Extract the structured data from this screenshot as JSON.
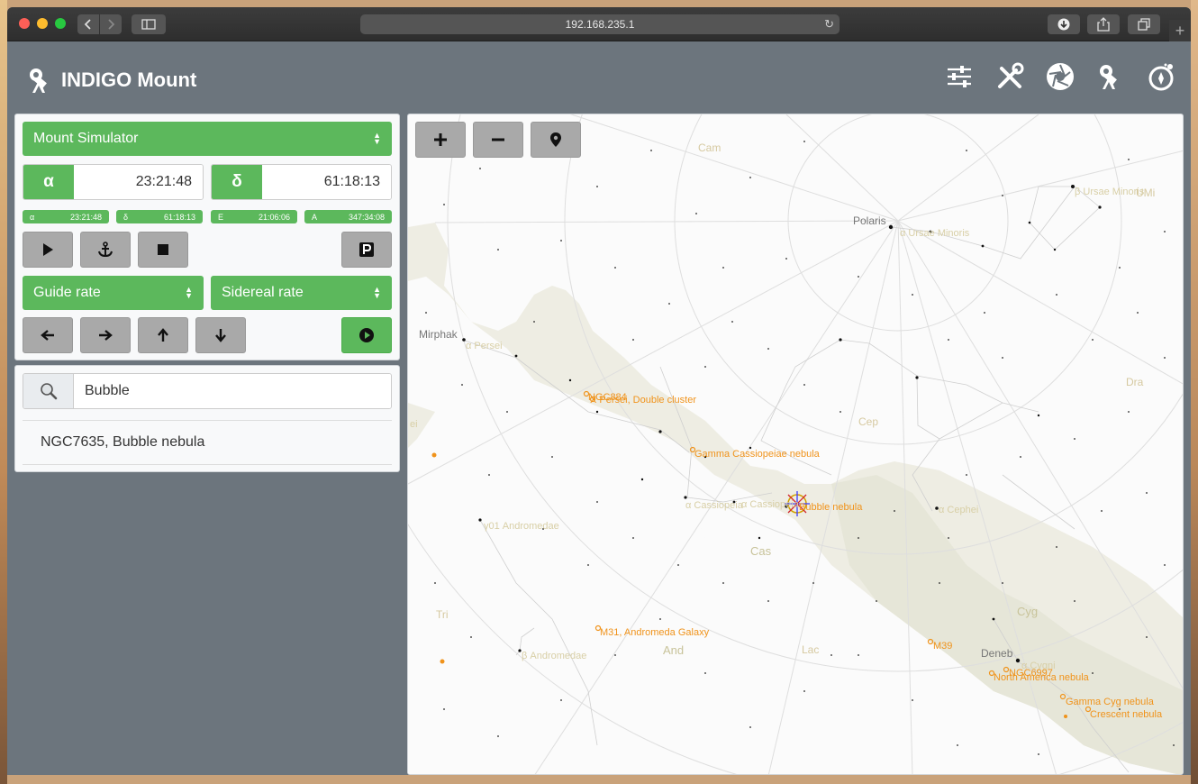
{
  "browser": {
    "url": "192.168.235.1"
  },
  "app": {
    "title": "INDIGO Mount",
    "top_icons": [
      "sliders-icon",
      "tools-icon",
      "aperture-icon",
      "telescope-icon",
      "sky-compass-icon"
    ]
  },
  "mount": {
    "device": "Mount Simulator",
    "alpha_label": "α",
    "alpha_value": "23:21:48",
    "delta_label": "δ",
    "delta_value": "61:18:13",
    "badges": [
      {
        "label": "α",
        "value": "23:21:48"
      },
      {
        "label": "δ",
        "value": "61:18:13"
      },
      {
        "label": "E",
        "value": "21:06:06"
      },
      {
        "label": "A",
        "value": "347:34:08"
      }
    ],
    "guide_rate": "Guide rate",
    "tracking_rate": "Sidereal rate"
  },
  "search": {
    "query": "Bubble",
    "results": [
      "NGC7635, Bubble nebula"
    ]
  },
  "map": {
    "constellations": [
      "Cam",
      "UMi",
      "Dra",
      "Cep",
      "Cas",
      "Cyg",
      "Lac",
      "And",
      "Tri"
    ],
    "stars": [
      "Polaris",
      "α Ursae Minoris",
      "β Ursae Minoris",
      "Mirphak",
      "α Persei",
      "α Cassiopeia",
      "α Cassiopeia",
      "α Cephei",
      "γ01 Andromedae",
      "β Andromedae",
      "Deneb",
      "α Cygni",
      "ei"
    ],
    "dso": [
      "NGC884",
      "X Persei, Double cluster",
      "Gamma Cassiopeiae nebula",
      "Bubble nebula",
      "M31, Andromeda Galaxy",
      "M39",
      "NGC6997",
      "North America nebula",
      "Gamma Cyg nebula",
      "Crescent nebula"
    ]
  }
}
